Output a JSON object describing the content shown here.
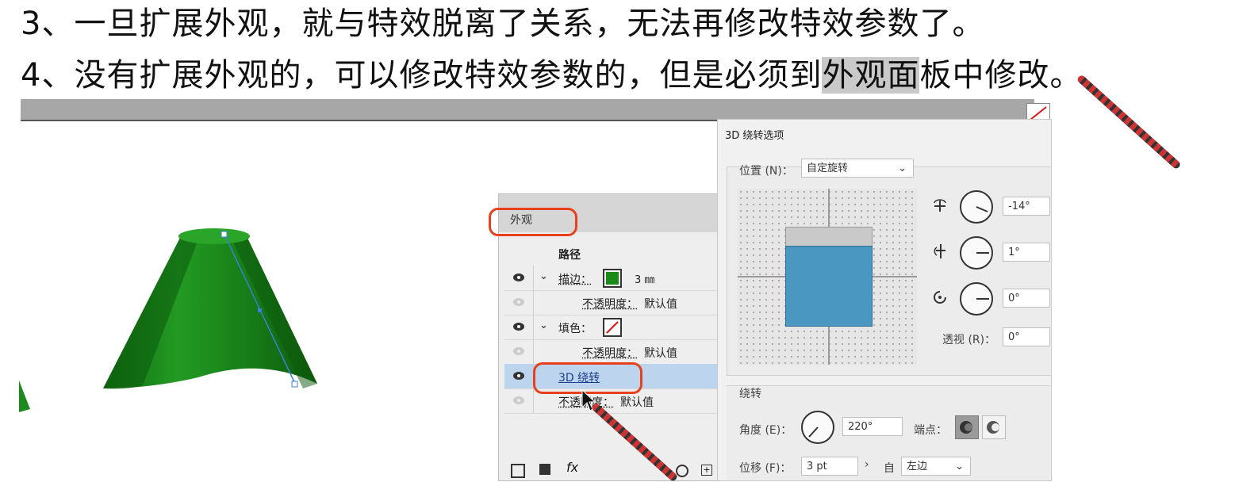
{
  "notes": {
    "line3": "3、一旦扩展外观，就与特效脱离了关系，无法再修改特效参数了。",
    "line4_prefix": "4、没有扩展外观的，可以修改特效参数的，但是必须到",
    "line4_highlight": "外观面",
    "line4_suffix": "板中修改。"
  },
  "appearance_panel": {
    "tab_label": "外观",
    "path_label": "路径",
    "stroke_label": "描边：",
    "stroke_value": "3 ㎜",
    "opacity_label": "不透明度：",
    "opacity_value": "默认值",
    "fill_label": "填色：",
    "effect_label": "3D 绕转",
    "fx_label": "fx"
  },
  "dialog_3d": {
    "title": "3D 绕转选项",
    "position_label": "位置 (N)：",
    "position_value": "自定旋转",
    "rot_x": "-14°",
    "rot_y": "1°",
    "rot_z": "0°",
    "perspective_label": "透视 (R)：",
    "perspective_value": "0°",
    "revolve_section": "绕转",
    "angle_label": "角度 (E)：",
    "angle_value": "220°",
    "cap_label": "端点：",
    "offset_label": "位移 (F)：",
    "offset_value": "3 pt",
    "from_label": "自",
    "from_value": "左边"
  },
  "colors": {
    "highlight_ring": "#e8401c",
    "cone_green": "#1e8a1e",
    "cube_blue": "#4a98c2",
    "selected_row": "#bcd4ee"
  }
}
